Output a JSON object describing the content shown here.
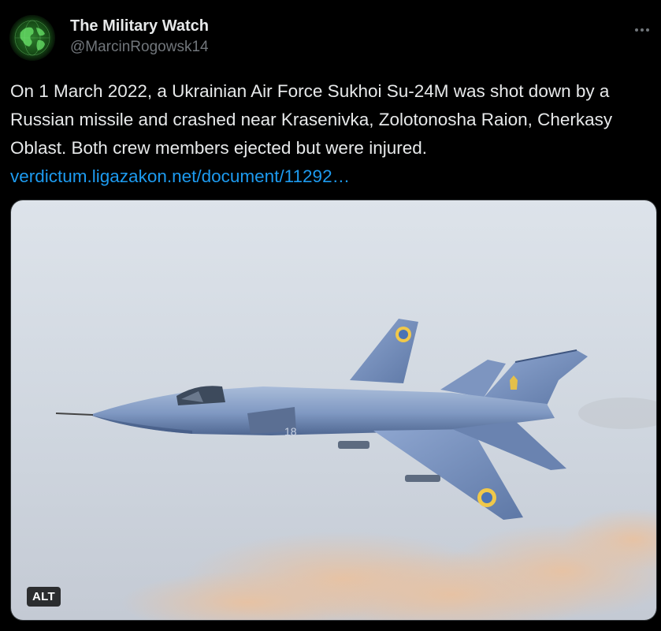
{
  "tweet": {
    "display_name": "The Military Watch",
    "handle": "@MarcinRogowsk14",
    "text": "On 1 March 2022, a Ukrainian Air Force Sukhoi Su-24M was shot down by a Russian missile and crashed near Krasenivka, Zolotonosha Raion, Cherkasy Oblast. Both crew members ejected but were injured.",
    "link_text": "verdictum.ligazakon.net/document/11292…",
    "media": {
      "alt_badge": "ALT",
      "tail_number": "18"
    },
    "avatar_icon": "globe-icon",
    "more_icon": "more-options-icon"
  },
  "colors": {
    "background": "#000000",
    "text": "#e7e9ea",
    "secondary_text": "#71767b",
    "link": "#1d9bf0"
  }
}
